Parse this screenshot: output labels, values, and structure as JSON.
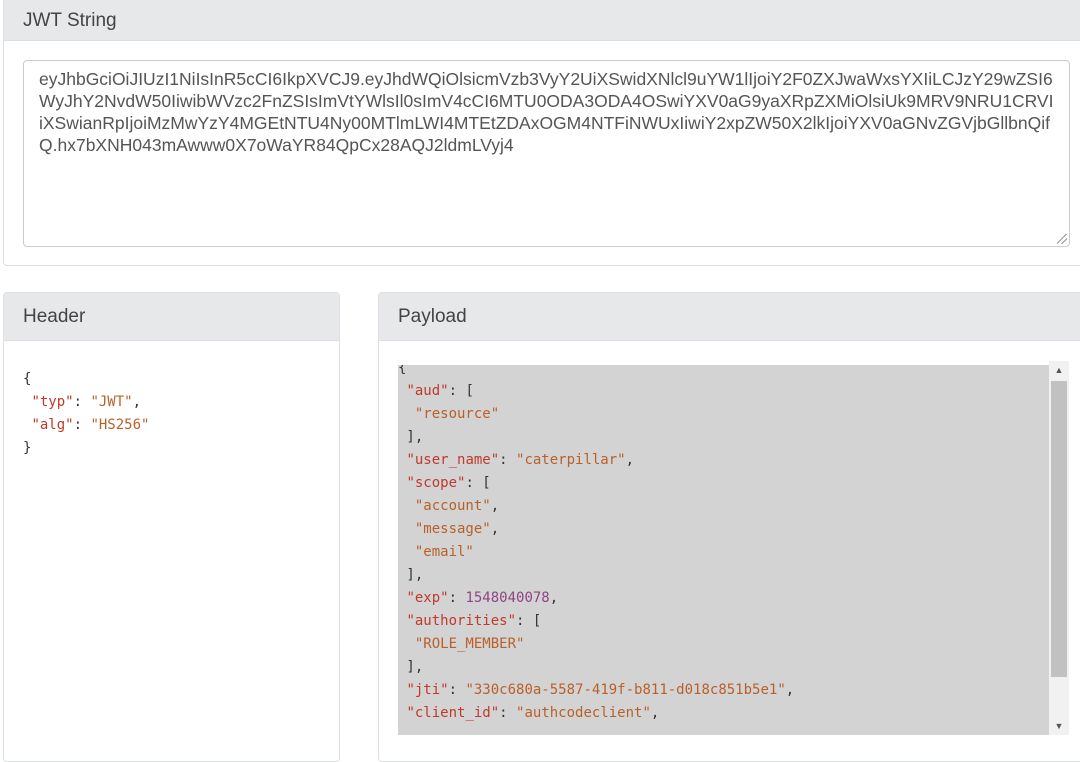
{
  "jwt_panel": {
    "title": "JWT String",
    "value": "eyJhbGciOiJIUzI1NiIsInR5cCI6IkpXVCJ9.eyJhdWQiOlsicmVzb3VyY2UiXSwidXNlcl9uYW1lIjoiY2F0ZXJwaWxsYXIiLCJzY29wZSI6WyJhY2NvdW50IiwibWVzc2FnZSIsImVtYWlsIl0sImV4cCI6MTU0ODA3ODA4OSwiYXV0aG9yaXRpZXMiOlsiUk9MRV9NRU1CRVIiXSwianRpIjoiMzMwYzY4MGEtNTU4Ny00MTlmLWI4MTEtZDAxOGM4NTFiNWUxIiwiY2xpZW50X2lkIjoiYXV0aGNvZGVjbGllbnQifQ.hx7bXNH043mAwww0X7oWaYR84QpCx28AQJ2ldmLVyj4"
  },
  "header_panel": {
    "title": "Header",
    "fields": [
      {
        "key": "\"typ\"",
        "value": "\"JWT\""
      },
      {
        "key": "\"alg\"",
        "value": "\"HS256\""
      }
    ]
  },
  "payload_panel": {
    "title": "Payload",
    "aud_key": "\"aud\"",
    "aud": [
      "\"resource\""
    ],
    "user_name_key": "\"user_name\"",
    "user_name": "\"caterpillar\"",
    "scope_key": "\"scope\"",
    "scope": [
      "\"account\"",
      "\"message\"",
      "\"email\""
    ],
    "exp_key": "\"exp\"",
    "exp": "1548040078",
    "authorities_key": "\"authorities\"",
    "authorities": [
      "\"ROLE_MEMBER\""
    ],
    "jti_key": "\"jti\"",
    "jti": "\"330c680a-5587-419f-b811-d018c851b5e1\"",
    "client_id_key": "\"client_id\"",
    "client_id": "\"authcodeclient\""
  },
  "colors": {
    "panel_header_bg": "#e7e8ea",
    "json_key": "#c0392b",
    "json_string": "#b9602a",
    "json_number": "#8e4585",
    "payload_bg": "#d3d3d3"
  }
}
